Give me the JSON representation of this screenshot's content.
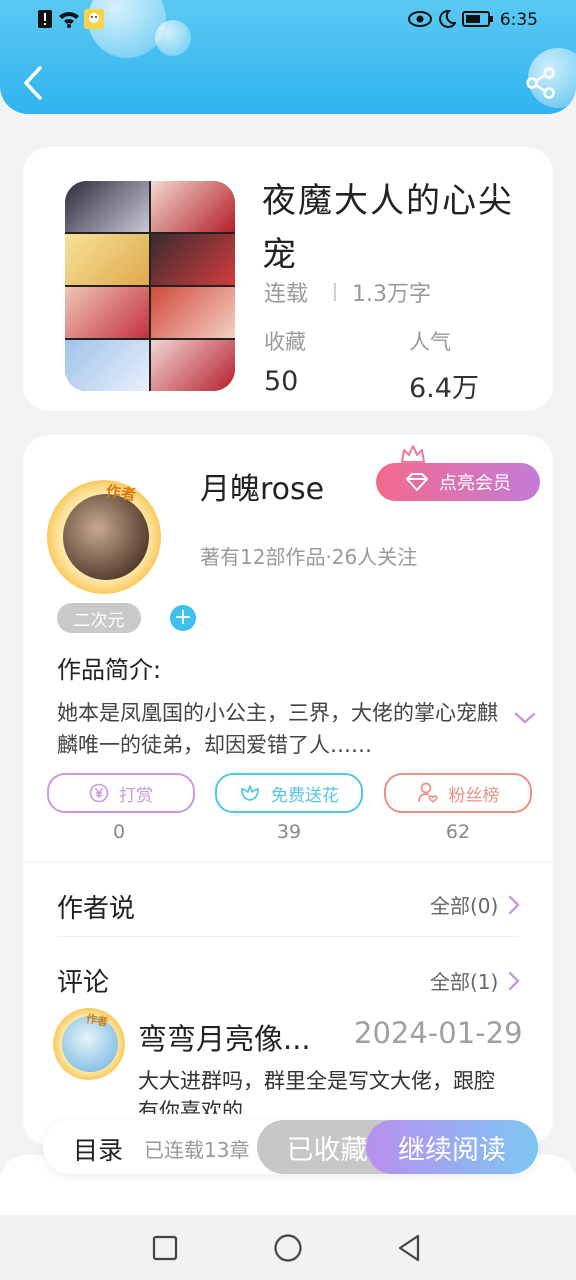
{
  "status_bar": {
    "time": "6:35"
  },
  "book": {
    "title": "夜魔大人的心尖宠",
    "status": "连载",
    "word_count": "1.3万字",
    "stats": [
      {
        "label": "收藏",
        "value": "50"
      },
      {
        "label": "人气",
        "value": "6.4万"
      }
    ]
  },
  "author": {
    "badge": "作者",
    "name": "月魄rose",
    "info": "著有12部作品·26人关注",
    "vip_label": "点亮会员"
  },
  "tag": "二次元",
  "intro": {
    "heading": "作品简介:",
    "text": "她本是凤凰国的小公主，三界，大佬的掌心宠麒麟唯一的徒弟，却因爱错了人……"
  },
  "actions": [
    {
      "label": "打赏",
      "count": "0",
      "color": "#c89ae0"
    },
    {
      "label": "免费送花",
      "count": "39",
      "color": "#54c6e4"
    },
    {
      "label": "粉丝榜",
      "count": "62",
      "color": "#ec8f86"
    }
  ],
  "author_says": {
    "title": "作者说",
    "link": "全部(0)"
  },
  "comments": {
    "title": "评论",
    "link": "全部(1)",
    "items": [
      {
        "badge": "作者",
        "name": "弯弯月亮像...",
        "date": "2024-01-29",
        "text": "大大进群吗，群里全是写文大佬，跟腔有你喜欢的"
      }
    ]
  },
  "bottom_bar": {
    "toc": "目录",
    "toc_sub": "已连载13章",
    "collected": "已收藏",
    "continue": "继续阅读"
  },
  "colors": {
    "header": "#35b6ef",
    "accent_purple": "#c79ae0",
    "vip_start": "#f36a8c",
    "vip_end": "#c37bd8"
  }
}
